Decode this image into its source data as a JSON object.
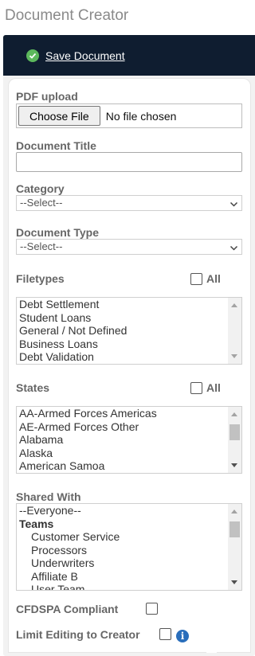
{
  "page": {
    "title": "Document Creator"
  },
  "toolbar": {
    "save_label": "Save Document",
    "save_icon": "check-circle-icon",
    "accent": "#5cb85c",
    "background": "#0f1d30"
  },
  "form": {
    "pdf_upload": {
      "label": "PDF upload",
      "button": "Choose File",
      "status": "No file chosen"
    },
    "document_title": {
      "label": "Document Title",
      "value": ""
    },
    "category": {
      "label": "Category",
      "selected": "--Select--"
    },
    "document_type": {
      "label": "Document Type",
      "selected": "--Select--"
    },
    "filetypes": {
      "label": "Filetypes",
      "all_label": "All",
      "options": [
        "Debt Settlement",
        "Student Loans",
        "General / Not Defined",
        "Business Loans",
        "Debt Validation"
      ]
    },
    "states": {
      "label": "States",
      "all_label": "All",
      "options": [
        "AA-Armed Forces Americas",
        "AE-Armed Forces Other",
        "Alabama",
        "Alaska",
        "American Samoa"
      ]
    },
    "shared_with": {
      "label": "Shared With",
      "options": [
        {
          "text": "--Everyone--",
          "kind": "plain"
        },
        {
          "text": "Teams",
          "kind": "group"
        },
        {
          "text": "Customer Service",
          "kind": "indent"
        },
        {
          "text": "Processors",
          "kind": "indent"
        },
        {
          "text": "Underwriters",
          "kind": "indent"
        },
        {
          "text": "Affiliate B",
          "kind": "indent"
        },
        {
          "text": "User Team",
          "kind": "indent"
        }
      ]
    },
    "cfdspa": {
      "label": "CFDSPA Compliant",
      "checked": false
    },
    "limit_editing": {
      "label": "Limit Editing to Creator",
      "checked": false,
      "info_icon": "info-icon"
    }
  }
}
